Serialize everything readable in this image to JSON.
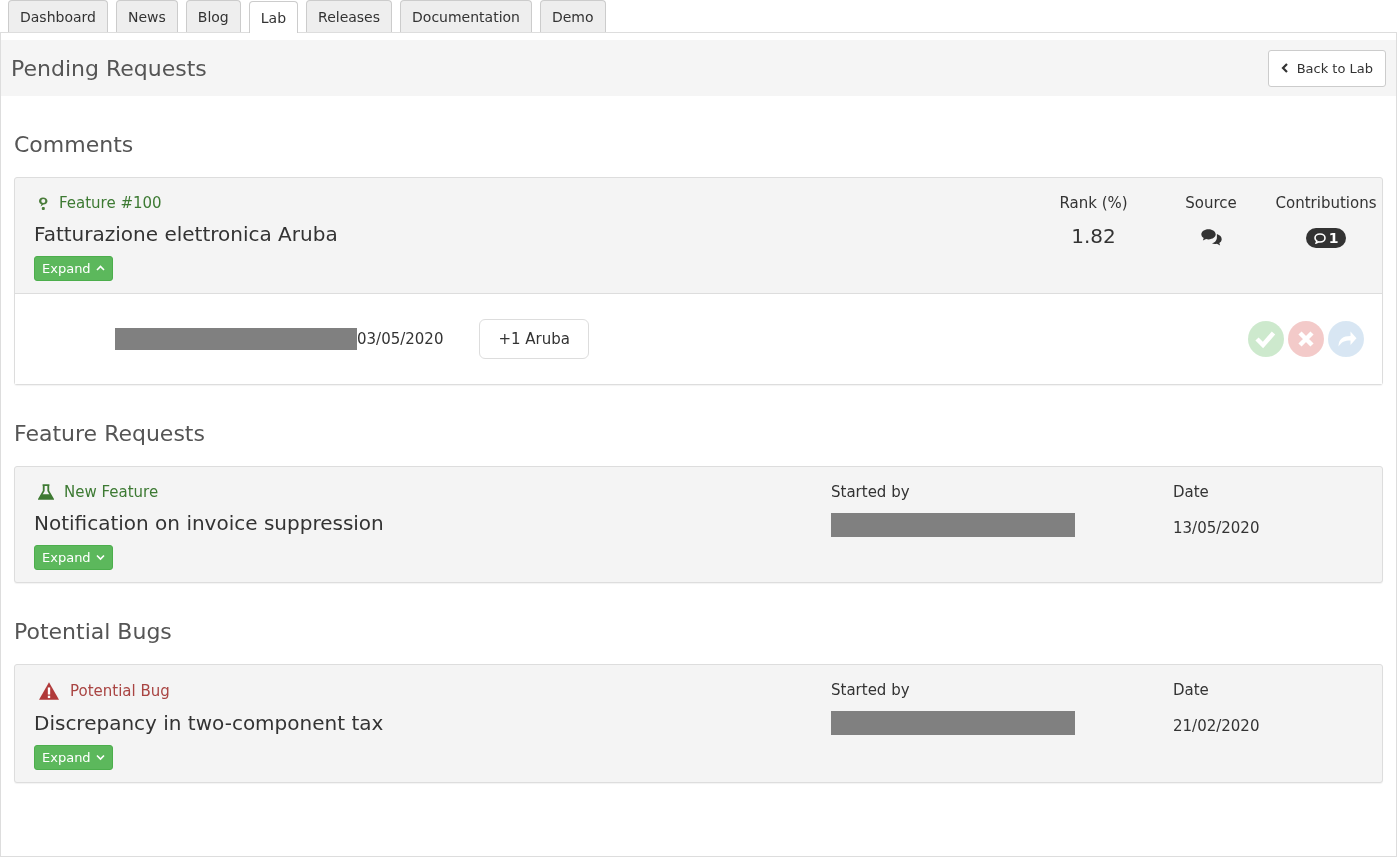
{
  "tabs": [
    {
      "label": "Dashboard",
      "selected": false
    },
    {
      "label": "News",
      "selected": false
    },
    {
      "label": "Blog",
      "selected": false
    },
    {
      "label": "Lab",
      "selected": true
    },
    {
      "label": "Releases",
      "selected": false
    },
    {
      "label": "Documentation",
      "selected": false
    },
    {
      "label": "Demo",
      "selected": false
    }
  ],
  "header": {
    "title": "Pending Requests",
    "back_button": "Back to Lab"
  },
  "sections": [
    {
      "title": "Comments",
      "cards": [
        {
          "kind": "comment",
          "category": "Feature #100",
          "title": "Fatturazione elettronica Aruba",
          "expand_label": "Expand",
          "expanded": true,
          "columns": [
            {
              "label": "Rank (%)",
              "value": "1.82",
              "kind": "text"
            },
            {
              "label": "Source",
              "kind": "source"
            },
            {
              "label": "Contributions",
              "value": "1",
              "kind": "badge"
            }
          ],
          "entries": [
            {
              "date": "03/05/2020",
              "comment": "+1 Aruba",
              "actions_disabled": true
            }
          ]
        }
      ]
    },
    {
      "title": "Feature Requests",
      "cards": [
        {
          "kind": "feature",
          "category": "New Feature",
          "title": "Notification on invoice suppression",
          "expand_label": "Expand",
          "expanded": false,
          "columns": [
            {
              "label": "Started by",
              "kind": "redacted"
            },
            {
              "label": "Date",
              "value": "13/05/2020",
              "kind": "text"
            }
          ]
        }
      ]
    },
    {
      "title": "Potential Bugs",
      "cards": [
        {
          "kind": "bug",
          "category": "Potential Bug",
          "title": "Discrepancy in two-component tax",
          "expand_label": "Expand",
          "expanded": false,
          "columns": [
            {
              "label": "Started by",
              "kind": "redacted"
            },
            {
              "label": "Date",
              "value": "21/02/2020",
              "kind": "text"
            }
          ]
        }
      ]
    }
  ]
}
